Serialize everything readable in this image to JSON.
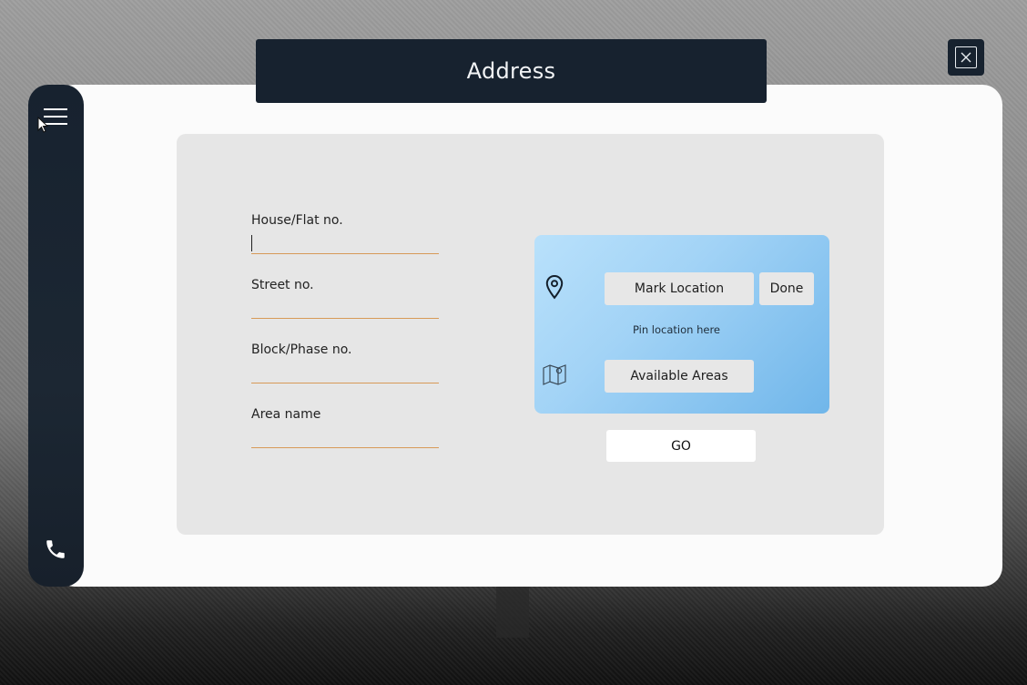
{
  "window": {
    "title": "Address"
  },
  "sidebar": {
    "menu_icon": "hamburger-menu-icon",
    "phone_icon": "phone-icon"
  },
  "form": {
    "fields": [
      {
        "label": "House/Flat no.",
        "value": ""
      },
      {
        "label": "Street no.",
        "value": ""
      },
      {
        "label": "Block/Phase no.",
        "value": ""
      },
      {
        "label": "Area name",
        "value": ""
      }
    ]
  },
  "location": {
    "mark_label": "Mark Location",
    "done_label": "Done",
    "hint": "Pin location here",
    "areas_label": "Available Areas",
    "pin_icon": "map-pin-icon",
    "map_icon": "map-icon"
  },
  "actions": {
    "go_label": "GO"
  },
  "colors": {
    "dark": "#17222f",
    "accent_underline": "#d79a58",
    "panel": "#e6e6e6",
    "loc_gradient_start": "#b9e1fb",
    "loc_gradient_end": "#70b6ea"
  }
}
